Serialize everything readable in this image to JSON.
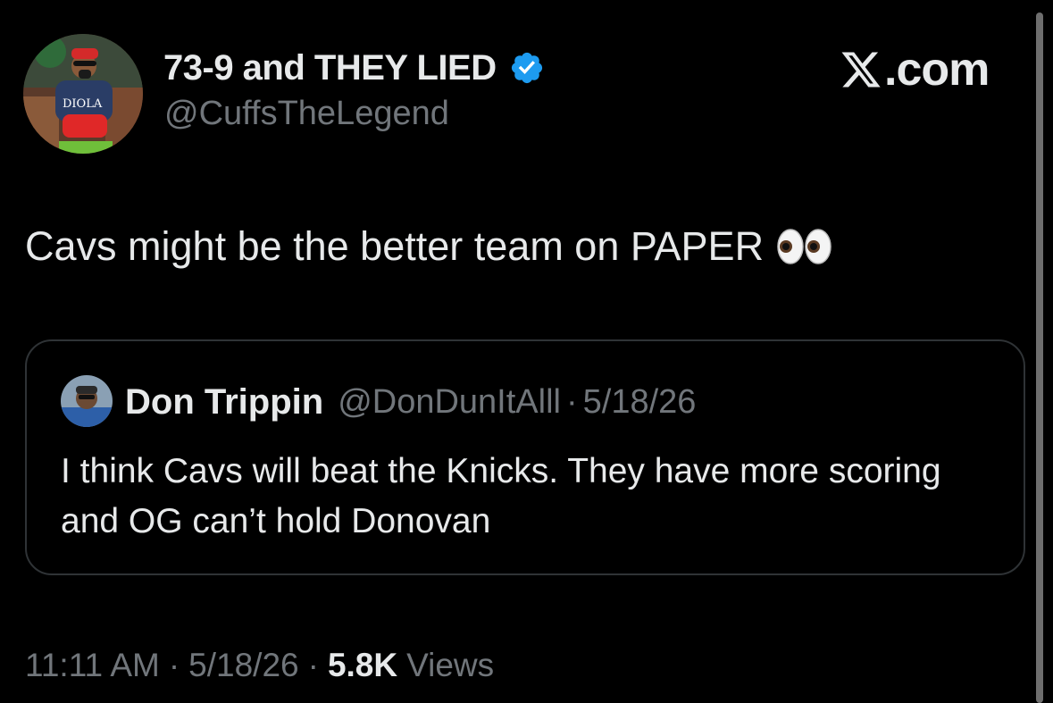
{
  "author": {
    "display_name": "73-9 and THEY LIED",
    "handle": "@CuffsTheLegend",
    "avatar_icon": "profile-photo",
    "verified_icon": "verified-badge-icon",
    "verified_color": "#1d9bf0"
  },
  "brand": {
    "logo_icon": "x-logo-icon",
    "text": ".com"
  },
  "tweet": {
    "text": "Cavs might be the better team on PAPER",
    "emoji_icon": "eyes-emoji-icon"
  },
  "quoted": {
    "name": "Don Trippin",
    "handle": "@DonDunItAlll",
    "separator": "·",
    "date": "5/18/26",
    "text": "I think Cavs will beat the Knicks. They have more scoring and OG can’t hold Donovan"
  },
  "meta": {
    "time": "11:11 AM",
    "separator": "·",
    "date": "5/18/26",
    "views_count": "5.8K",
    "views_label": "Views"
  },
  "colors": {
    "background": "#000000",
    "text_primary": "#e7e9ea",
    "text_secondary": "#71767b",
    "border": "#2f3336"
  }
}
